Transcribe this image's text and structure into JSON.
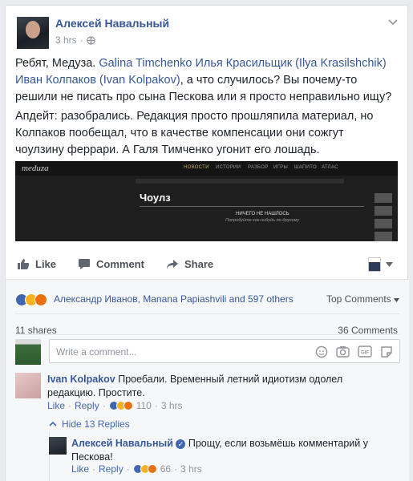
{
  "post": {
    "author": "Алексей Навальный",
    "time": "3 hrs",
    "meta_dot": "·",
    "text_p1": {
      "lead": "Ребят, Медуза. ",
      "mention1": "Galina Timchenko",
      "mention2": "Илья Красильщик (Ilya Krasilshchik)",
      "mention3": "Иван Колпаков (Ivan Kolpakov)",
      "line2_tail": ", а что случилось? Вы почему-то",
      "line3": "решили не писать про сына Пескова или я просто неправильно ищу?"
    },
    "text_p2": {
      "line1": "Апдейт: разобрались. Редакция просто прошляпила материал, но",
      "line2": "Колпаков пообещал, что в качестве компенсации они сожгут",
      "line3": "чоулзину феррари. А Галя Тимченко угонит его лошадь."
    },
    "embed": {
      "logo": "meduza",
      "nav": [
        "НОВОСТИ",
        "ИСТОРИИ",
        "РАЗБОР",
        "ИГРЫ",
        "ШАПИТО",
        "АТЛАС"
      ],
      "search_query": "Чоулз",
      "not_found_title": "НИЧЕГО НЕ НАШЛОСЬ",
      "not_found_sub": "Попробуйте как-нибудь по-другому"
    }
  },
  "actions": {
    "like": "Like",
    "comment": "Comment",
    "share": "Share"
  },
  "reactions": {
    "names": "Александр Иванов, Manana Papiashvili and 597 others",
    "sort": "Top Comments"
  },
  "counts": {
    "shares": "11 shares",
    "comments": "36 Comments"
  },
  "composer": {
    "placeholder": "Write a comment..."
  },
  "comments": [
    {
      "name": "Ivan Kolpakov",
      "text_line1": "Проебали. Временный летний идиотизм одолел",
      "text_line2": "редакцию. Простите.",
      "like": "Like",
      "reply": "Reply",
      "sep": "·",
      "reaction_count": "110",
      "time": "3 hrs"
    }
  ],
  "hide_replies": "Hide 13 Replies",
  "reply": {
    "name": "Алексей Навальный",
    "text_line1": "Прощу, если возьмёшь комментарий у",
    "text_line2": "Пескова!",
    "like": "Like",
    "reply": "Reply",
    "sep": "·",
    "reaction_count": "66",
    "time": "3 hrs"
  },
  "colors": {
    "link": "#365899",
    "muted": "#90949c",
    "like_blue": "#4267b2"
  }
}
